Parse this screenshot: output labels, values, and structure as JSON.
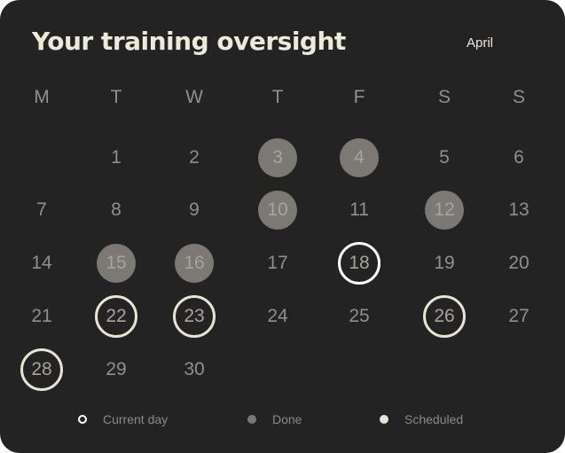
{
  "title": "Your training oversight",
  "month": "April",
  "weekdays": [
    "M",
    "T",
    "W",
    "T",
    "F",
    "S",
    "S"
  ],
  "days": [
    {
      "n": "1",
      "status": "none"
    },
    {
      "n": "2",
      "status": "none"
    },
    {
      "n": "3",
      "status": "done"
    },
    {
      "n": "4",
      "status": "done"
    },
    {
      "n": "5",
      "status": "none"
    },
    {
      "n": "6",
      "status": "none"
    },
    {
      "n": "7",
      "status": "none"
    },
    {
      "n": "8",
      "status": "none"
    },
    {
      "n": "9",
      "status": "none"
    },
    {
      "n": "10",
      "status": "done"
    },
    {
      "n": "11",
      "status": "none"
    },
    {
      "n": "12",
      "status": "done"
    },
    {
      "n": "13",
      "status": "none"
    },
    {
      "n": "14",
      "status": "none"
    },
    {
      "n": "15",
      "status": "done"
    },
    {
      "n": "16",
      "status": "done"
    },
    {
      "n": "17",
      "status": "none"
    },
    {
      "n": "18",
      "status": "current"
    },
    {
      "n": "19",
      "status": "none"
    },
    {
      "n": "20",
      "status": "none"
    },
    {
      "n": "21",
      "status": "none"
    },
    {
      "n": "22",
      "status": "scheduled"
    },
    {
      "n": "23",
      "status": "scheduled"
    },
    {
      "n": "24",
      "status": "none"
    },
    {
      "n": "25",
      "status": "none"
    },
    {
      "n": "26",
      "status": "scheduled"
    },
    {
      "n": "27",
      "status": "none"
    },
    {
      "n": "28",
      "status": "scheduled"
    },
    {
      "n": "29",
      "status": "none"
    },
    {
      "n": "30",
      "status": "none"
    }
  ],
  "legend": {
    "current": "Current day",
    "done": "Done",
    "scheduled": "Scheduled"
  },
  "colors": {
    "background": "#232323",
    "done": "#7c7873",
    "scheduled": "#e7e5d2",
    "current": "#ffffff",
    "text_muted": "#8f8f8f",
    "title": "#ecead9"
  }
}
